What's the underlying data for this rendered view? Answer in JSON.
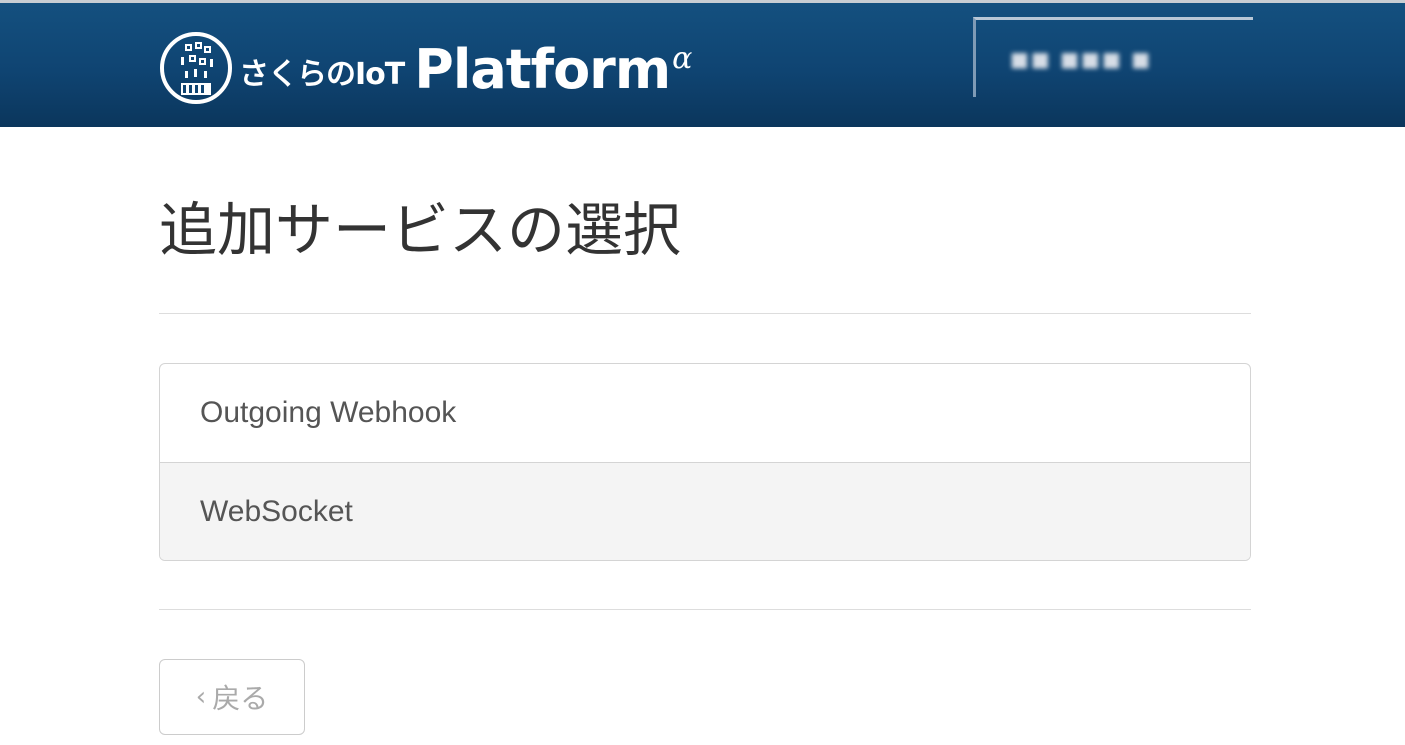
{
  "header": {
    "logo_sakura_text": "さくらのIoT",
    "logo_platform_text": "Platform",
    "logo_alpha_text": "α",
    "user_name": "■■ ■■■ ■",
    "colors": {
      "header_bg": "#0f4472",
      "logo_text": "#ffffff"
    }
  },
  "main": {
    "title": "追加サービスの選択",
    "services": [
      {
        "label": "Outgoing Webhook"
      },
      {
        "label": "WebSocket"
      }
    ],
    "back_button": {
      "chevron": "‹",
      "label": "戻る"
    }
  }
}
